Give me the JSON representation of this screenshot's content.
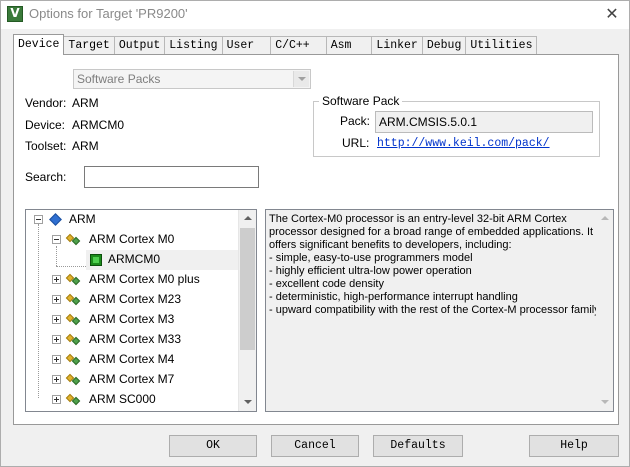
{
  "window": {
    "title": "Options for Target 'PR9200'"
  },
  "tabs": [
    "Device",
    "Target",
    "Output",
    "Listing",
    "User",
    "C/C++",
    "Asm",
    "Linker",
    "Debug",
    "Utilities"
  ],
  "active_tab": "Device",
  "device": {
    "combo_value": "Software Packs",
    "vendor_label": "Vendor:",
    "vendor_value": "ARM",
    "device_label": "Device:",
    "device_value": "ARMCM0",
    "toolset_label": "Toolset:",
    "toolset_value": "ARM",
    "search_label": "Search:",
    "search_value": ""
  },
  "software_pack": {
    "title": "Software Pack",
    "pack_label": "Pack:",
    "pack_value": "ARM.CMSIS.5.0.1",
    "url_label": "URL:",
    "url_value": "http://www.keil.com/pack/"
  },
  "tree": {
    "root": "ARM",
    "items": [
      {
        "label": "ARM Cortex M0",
        "expanded": true
      },
      {
        "label": "ARMCM0",
        "selected": true
      },
      {
        "label": "ARM Cortex M0 plus"
      },
      {
        "label": "ARM Cortex M23"
      },
      {
        "label": "ARM Cortex M3"
      },
      {
        "label": "ARM Cortex M33"
      },
      {
        "label": "ARM Cortex M4"
      },
      {
        "label": "ARM Cortex M7"
      },
      {
        "label": "ARM SC000"
      }
    ]
  },
  "description": [
    "The Cortex-M0 processor is an entry-level 32-bit ARM Cortex",
    "processor designed for a broad range of embedded applications. It",
    "offers significant benefits to developers, including:",
    "- simple, easy-to-use programmers model",
    "- highly efficient ultra-low power operation",
    "- excellent code density",
    "- deterministic, high-performance interrupt handling",
    "- upward compatibility with the rest of the Cortex-M processor family."
  ],
  "buttons": {
    "ok": "OK",
    "cancel": "Cancel",
    "defaults": "Defaults",
    "help": "Help"
  }
}
